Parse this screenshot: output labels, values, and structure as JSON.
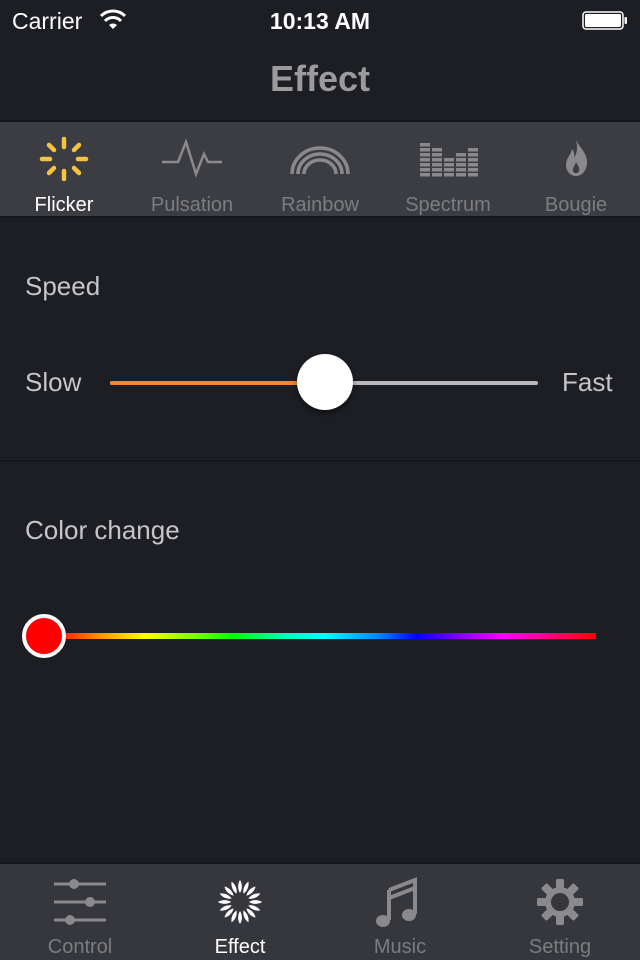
{
  "status_bar": {
    "carrier": "Carrier",
    "time": "10:13 AM",
    "wifi_icon": "wifi-icon",
    "battery_icon": "battery-full-icon"
  },
  "nav": {
    "title": "Effect"
  },
  "effects": {
    "selected": "Flicker",
    "items": [
      {
        "label": "Flicker",
        "icon": "flicker-icon",
        "active": true
      },
      {
        "label": "Pulsation",
        "icon": "pulse-icon",
        "active": false
      },
      {
        "label": "Rainbow",
        "icon": "rainbow-icon",
        "active": false
      },
      {
        "label": "Spectrum",
        "icon": "spectrum-icon",
        "active": false
      },
      {
        "label": "Bougie",
        "icon": "flame-icon",
        "active": false
      }
    ]
  },
  "speed": {
    "label": "Speed",
    "min_label": "Slow",
    "max_label": "Fast",
    "value": 0.5
  },
  "color_change": {
    "label": "Color change",
    "value": 0.0,
    "selected_color": "#ff0000"
  },
  "tabbar": {
    "selected": "Effect",
    "items": [
      {
        "label": "Control",
        "icon": "sliders-icon",
        "active": false
      },
      {
        "label": "Effect",
        "icon": "effect-burst-icon",
        "active": true
      },
      {
        "label": "Music",
        "icon": "music-note-icon",
        "active": false
      },
      {
        "label": "Setting",
        "icon": "gear-icon",
        "active": false
      }
    ]
  },
  "colors": {
    "accent_yellow": "#f5c342",
    "speed_fill": "#f5862f",
    "inactive": "#7c7d81"
  }
}
